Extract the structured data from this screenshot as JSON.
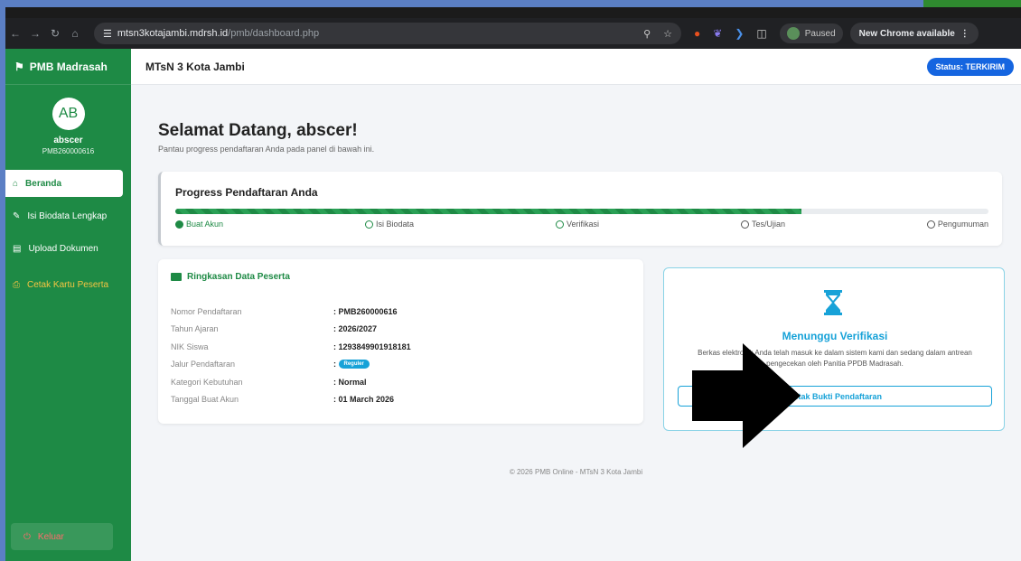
{
  "browser": {
    "url_domain": "mtsn3kotajambi.mdrsh.id",
    "url_path": "/pmb/dashboard.php",
    "paused_label": "Paused",
    "new_chrome_label": "New Chrome available"
  },
  "sidebar": {
    "brand": "PMB Madrasah",
    "avatar_initials": "AB",
    "user_name": "abscer",
    "user_id": "PMB260000616",
    "items": [
      {
        "label": "Beranda",
        "icon": "home-icon"
      },
      {
        "label": "Isi Biodata Lengkap",
        "icon": "user-edit-icon"
      },
      {
        "label": "Upload Dokumen",
        "icon": "file-upload-icon"
      },
      {
        "label": "Cetak Kartu Peserta",
        "icon": "print-icon"
      }
    ],
    "logout_label": "Keluar"
  },
  "header": {
    "school_name": "MTsN 3 Kota Jambi",
    "status_label": "Status: TERKIRIM"
  },
  "main": {
    "welcome_title": "Selamat Datang, abscer!",
    "welcome_subtitle": "Pantau progress pendaftaran Anda pada panel di bawah ini.",
    "progress": {
      "title": "Progress Pendaftaran Anda",
      "fraction": 0.77,
      "steps": [
        "Buat Akun",
        "Isi Biodata",
        "Verifikasi",
        "Tes/Ujian",
        "Pengumuman"
      ]
    },
    "summary": {
      "title": "Ringkasan Data Peserta",
      "rows": [
        {
          "label": "Nomor Pendaftaran",
          "value": ": PMB260000616"
        },
        {
          "label": "Tahun Ajaran",
          "value": ": 2026/2027"
        },
        {
          "label": "NIK Siswa",
          "value": ": 1293849901918181"
        },
        {
          "label": "Jalur Pendaftaran",
          "value": ":",
          "pill": "Reguler"
        },
        {
          "label": "Kategori Kebutuhan",
          "value": ": Normal"
        },
        {
          "label": "Tanggal Buat Akun",
          "value": ": 01 March 2026"
        }
      ]
    },
    "verify": {
      "title": "Menunggu Verifikasi",
      "text": "Berkas elektronik Anda telah masuk ke dalam sistem kami dan sedang dalam antrean pengecekan oleh Panitia PPDB Madrasah.",
      "button_label": "Cetak Bukti Pendaftaran"
    },
    "footer": "© 2026 PMB Online - MTsN 3 Kota Jambi"
  },
  "colors": {
    "sidebar": "#1e8a45",
    "accent": "#17a2d8",
    "status": "#1565e0"
  }
}
